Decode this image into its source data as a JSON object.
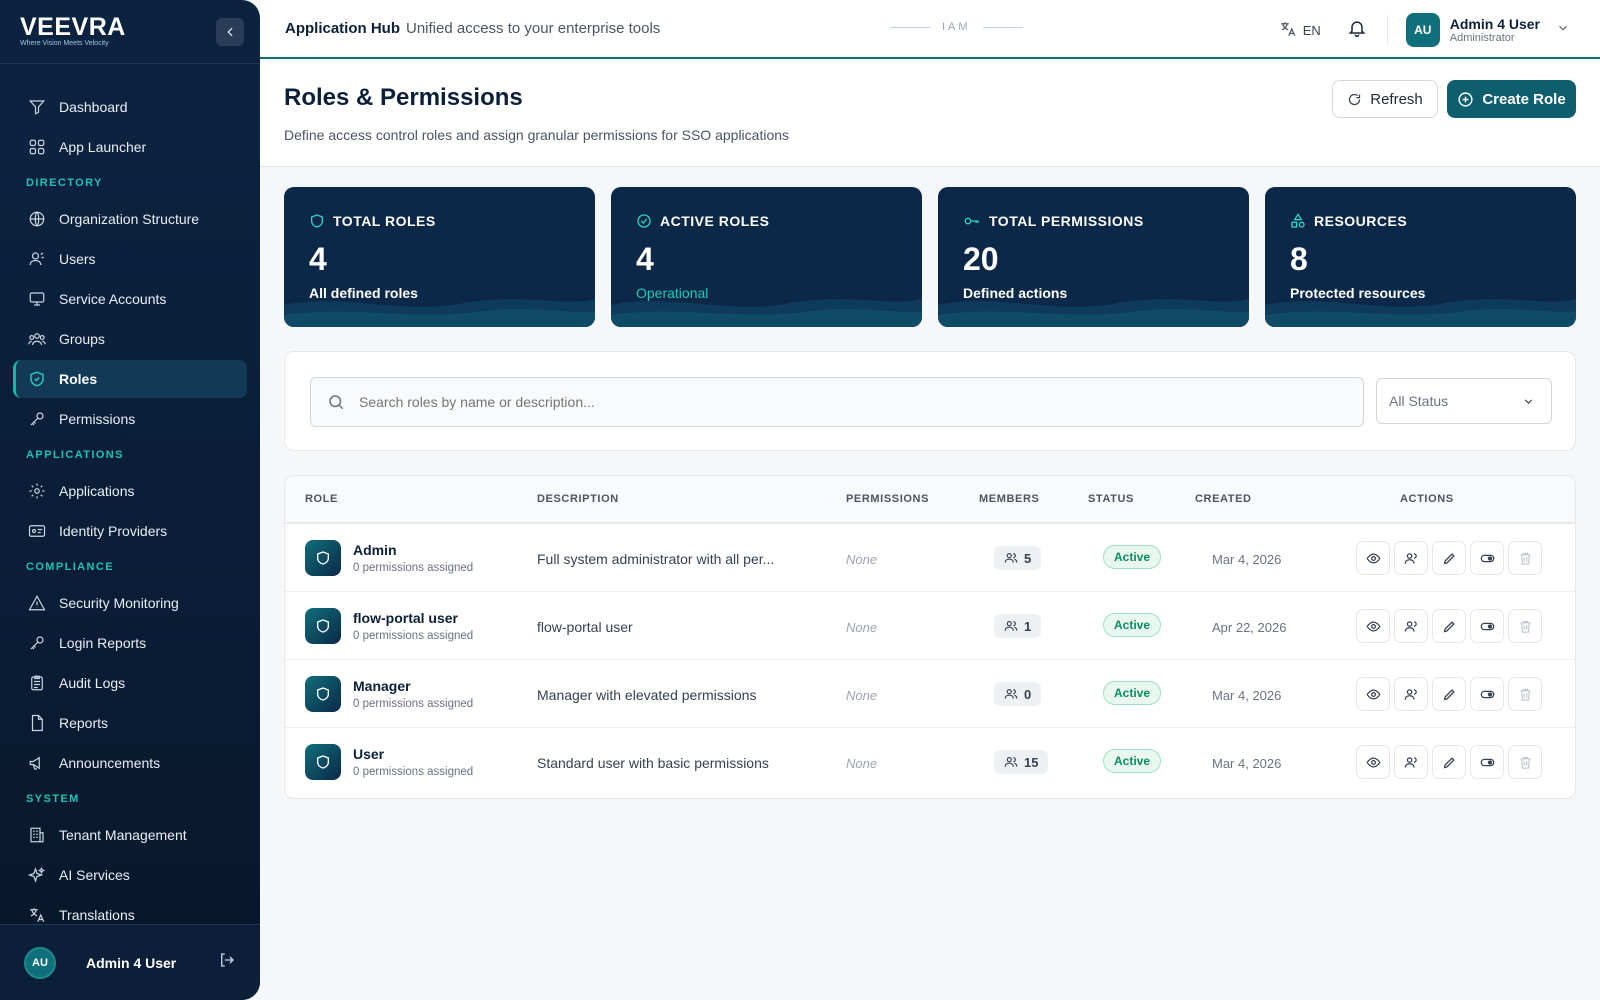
{
  "brand": {
    "name": "VEEVRA",
    "tagline": "Where Vision Meets Velocity"
  },
  "sidebar": {
    "items": [
      {
        "label": "Dashboard",
        "icon": "filter-icon"
      },
      {
        "label": "App Launcher",
        "icon": "grid-icon"
      }
    ],
    "sections": [
      {
        "title": "DIRECTORY",
        "items": [
          {
            "label": "Organization Structure",
            "icon": "globe-icon"
          },
          {
            "label": "Users",
            "icon": "users-icon"
          },
          {
            "label": "Service Accounts",
            "icon": "monitor-icon"
          },
          {
            "label": "Groups",
            "icon": "group-icon"
          },
          {
            "label": "Roles",
            "icon": "shield-icon",
            "active": true
          },
          {
            "label": "Permissions",
            "icon": "key-icon"
          }
        ]
      },
      {
        "title": "APPLICATIONS",
        "items": [
          {
            "label": "Applications",
            "icon": "gear-icon"
          },
          {
            "label": "Identity Providers",
            "icon": "id-card-icon"
          }
        ]
      },
      {
        "title": "COMPLIANCE",
        "items": [
          {
            "label": "Security Monitoring",
            "icon": "warning-icon"
          },
          {
            "label": "Login Reports",
            "icon": "key-icon"
          },
          {
            "label": "Audit Logs",
            "icon": "clipboard-icon"
          },
          {
            "label": "Reports",
            "icon": "document-icon"
          },
          {
            "label": "Announcements",
            "icon": "megaphone-icon"
          }
        ]
      },
      {
        "title": "SYSTEM",
        "items": [
          {
            "label": "Tenant Management",
            "icon": "building-icon"
          },
          {
            "label": "AI Services",
            "icon": "sparkles-icon"
          },
          {
            "label": "Translations",
            "icon": "translate-icon"
          }
        ]
      }
    ],
    "footer": {
      "initials": "AU",
      "name": "Admin 4 User"
    }
  },
  "header": {
    "title": "Application Hub",
    "subtitle": "Unified access to your enterprise tools",
    "center_tag": "IAM",
    "language": "EN",
    "user": {
      "initials": "AU",
      "name": "Admin 4 User",
      "role": "Administrator"
    }
  },
  "page": {
    "title": "Roles & Permissions",
    "description": "Define access control roles and assign granular permissions for SSO applications",
    "refresh_label": "Refresh",
    "create_label": "Create Role"
  },
  "stats": [
    {
      "label": "TOTAL ROLES",
      "value": "4",
      "sub": "All defined roles",
      "icon": "shield-icon"
    },
    {
      "label": "ACTIVE ROLES",
      "value": "4",
      "sub": "Operational",
      "icon": "check-circle-icon"
    },
    {
      "label": "TOTAL PERMISSIONS",
      "value": "20",
      "sub": "Defined actions",
      "icon": "key-icon"
    },
    {
      "label": "RESOURCES",
      "value": "8",
      "sub": "Protected resources",
      "icon": "shapes-icon"
    }
  ],
  "colors": {
    "accent": "#0f5e6e",
    "teal": "#14b8a6",
    "navy": "#0b2848",
    "active_green": "#0f8a5f"
  },
  "filter": {
    "search_placeholder": "Search roles by name or description...",
    "status_value": "All Status"
  },
  "table": {
    "headers": [
      "ROLE",
      "DESCRIPTION",
      "PERMISSIONS",
      "MEMBERS",
      "STATUS",
      "CREATED",
      "ACTIONS"
    ],
    "rows": [
      {
        "name": "Admin",
        "sub": "0 permissions assigned",
        "description": "Full system administrator with all per...",
        "permissions": "None",
        "members": "5",
        "status": "Active",
        "created": "Mar 4, 2026"
      },
      {
        "name": "flow-portal user",
        "sub": "0 permissions assigned",
        "description": "flow-portal user",
        "permissions": "None",
        "members": "1",
        "status": "Active",
        "created": "Apr 22, 2026"
      },
      {
        "name": "Manager",
        "sub": "0 permissions assigned",
        "description": "Manager with elevated permissions",
        "permissions": "None",
        "members": "0",
        "status": "Active",
        "created": "Mar 4, 2026"
      },
      {
        "name": "User",
        "sub": "0 permissions assigned",
        "description": "Standard user with basic permissions",
        "permissions": "None",
        "members": "15",
        "status": "Active",
        "created": "Mar 4, 2026"
      }
    ]
  }
}
